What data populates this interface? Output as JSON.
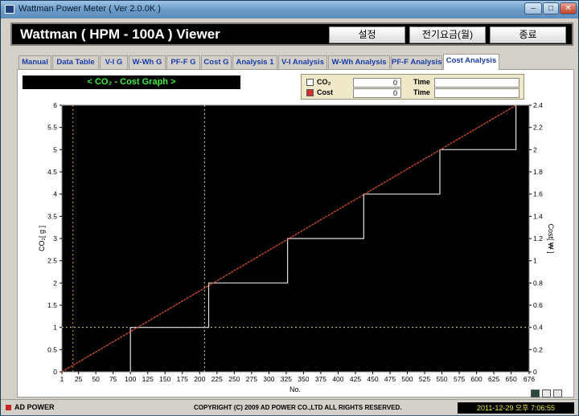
{
  "window": {
    "title": "Wattman Power Meter ( Ver 2.0.0K )",
    "min_glyph": "–",
    "max_glyph": "□",
    "close_glyph": "✕"
  },
  "header": {
    "app_title": "Wattman ( HPM - 100A ) Viewer",
    "buttons": [
      "설정",
      "전기요금(월)",
      "종료"
    ]
  },
  "tabs": [
    "Manual",
    "Data Table",
    "V-I G",
    "W-Wh G",
    "PF-F G",
    "Cost G",
    "Analysis 1",
    "V-I Analysis",
    "W-Wh Analysis",
    "PF-F Analysis",
    "Cost Analysis"
  ],
  "active_tab": "Cost Analysis",
  "graph_title": "< CO₂  - Cost Graph >",
  "legend": {
    "rows": [
      {
        "label": "CO₂",
        "value": "0",
        "time_label": "Time",
        "time_value": "",
        "color": "#ffffff"
      },
      {
        "label": "Cost",
        "value": "0",
        "time_label": "Time",
        "time_value": "",
        "color": "#d32f2f"
      }
    ]
  },
  "chart_data": {
    "type": "line",
    "xlabel": "No.",
    "ylabel_left": "CO₂[ g ]",
    "ylabel_right": "Cost[ ₩ ]",
    "xlim": [
      1,
      676
    ],
    "ylim_left": [
      0,
      6
    ],
    "ylim_right": [
      0,
      2.4
    ],
    "x_ticks": [
      "1",
      "25",
      "50",
      "75",
      "100",
      "125",
      "150",
      "175",
      "200",
      "225",
      "250",
      "275",
      "300",
      "325",
      "350",
      "375",
      "400",
      "425",
      "450",
      "475",
      "500",
      "525",
      "550",
      "575",
      "600",
      "625",
      "650",
      "676"
    ],
    "y_left_ticks": [
      "0",
      "0.5",
      "1",
      "1.5",
      "2",
      "2.5",
      "3",
      "3.5",
      "4",
      "4.5",
      "5",
      "5.5",
      "6"
    ],
    "y_right_ticks": [
      "0",
      "0.2",
      "0.4",
      "0.6",
      "0.8",
      "1",
      "1.2",
      "1.4",
      "1.6",
      "1.8",
      "2",
      "2.2",
      "2.4"
    ],
    "background": "#000000",
    "series": [
      {
        "name": "CO₂",
        "axis": "left",
        "color": "#e0e0e0",
        "style": "step",
        "points": [
          [
            100,
            0
          ],
          [
            100,
            1
          ],
          [
            213,
            1
          ],
          [
            213,
            2
          ],
          [
            327,
            2
          ],
          [
            327,
            3
          ],
          [
            437,
            3
          ],
          [
            437,
            4
          ],
          [
            547,
            4
          ],
          [
            547,
            5
          ],
          [
            657,
            5
          ],
          [
            657,
            6
          ]
        ]
      },
      {
        "name": "Cost",
        "axis": "right",
        "color": "#e8552b",
        "style": "line",
        "points": [
          [
            1,
            0
          ],
          [
            657,
            2.4
          ]
        ]
      }
    ],
    "cursor_lines": [
      {
        "x": 17,
        "color": "#d9a23a"
      },
      {
        "x": 207,
        "color": "#d9d9a0"
      },
      {
        "y_left": 1,
        "color": "#d9d9a0"
      }
    ]
  },
  "footer": {
    "logo": "AD POWER",
    "copyright": "COPYRIGHT (C) 2009 AD POWER CO.,LTD ALL RIGHTS RESERVED.",
    "datetime": "2011-12-29 오후 7:06:55"
  }
}
